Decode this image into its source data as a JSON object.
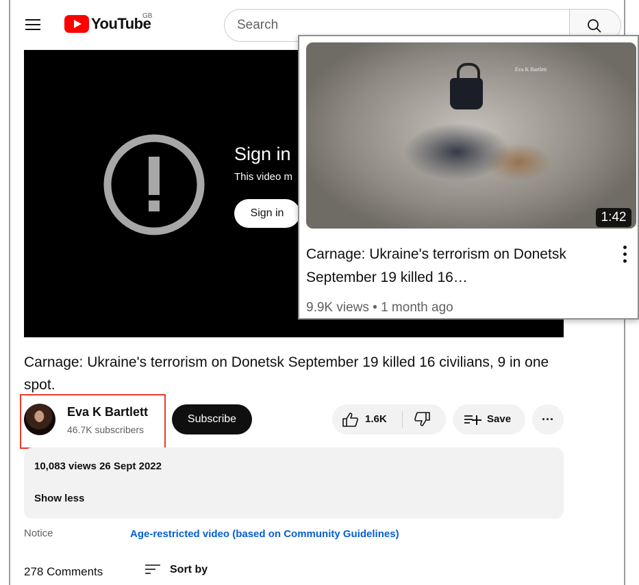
{
  "header": {
    "menu_icon": "hamburger-icon",
    "logo_text": "YouTube",
    "logo_region": "GB",
    "search_placeholder": "Search",
    "search_icon": "search-icon"
  },
  "player": {
    "title": "Sign in",
    "subtitle": "This video m",
    "sign_in_label": "Sign in",
    "warning_icon": "exclamation-circle-icon"
  },
  "video": {
    "title": "Carnage: Ukraine's terrorism on Donetsk September 19 killed 16 civilians, 9 in one spot.",
    "channel_name": "Eva K Bartlett",
    "subscribers": "46.7K subscribers",
    "subscribe_label": "Subscribe",
    "likes": "1.6K",
    "save_label": "Save",
    "more_label": "···"
  },
  "description": {
    "meta": "10,083 views  26 Sept 2022",
    "show_less": "Show less",
    "notice_label": "Notice",
    "notice_value": "Age-restricted video (based on Community Guidelines)"
  },
  "comments": {
    "count": "278 Comments",
    "sort_label": "Sort by"
  },
  "popup": {
    "duration": "1:42",
    "watermark": "Eva K Bartlett",
    "title": "Carnage: Ukraine's terrorism on Donetsk September 19 killed 16…",
    "meta": "9.9K views • 1 month ago"
  },
  "colors": {
    "brand_red": "#ff0000",
    "highlight_red": "#e8392a",
    "link_blue": "#065fd4"
  }
}
